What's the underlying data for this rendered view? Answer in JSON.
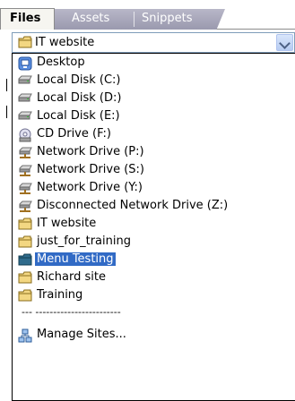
{
  "tabs": {
    "files": "Files",
    "assets": "Assets",
    "snippets": "Snippets"
  },
  "site_select": {
    "value": "IT website"
  },
  "dropdown": {
    "items": [
      {
        "label": "Desktop",
        "icon": "desktop-icon"
      },
      {
        "label": "Local Disk (C:)",
        "icon": "hard-disk-icon"
      },
      {
        "label": "Local Disk (D:)",
        "icon": "hard-disk-icon"
      },
      {
        "label": "Local Disk (E:)",
        "icon": "hard-disk-icon"
      },
      {
        "label": "CD Drive (F:)",
        "icon": "cd-drive-icon"
      },
      {
        "label": "Network Drive (P:)",
        "icon": "network-drive-icon"
      },
      {
        "label": "Network Drive (S:)",
        "icon": "network-drive-icon"
      },
      {
        "label": "Network Drive (Y:)",
        "icon": "network-drive-icon"
      },
      {
        "label": "Disconnected Network Drive (Z:)",
        "icon": "network-drive-icon"
      },
      {
        "label": "IT website",
        "icon": "folder-icon"
      },
      {
        "label": "just_for_training",
        "icon": "folder-icon"
      },
      {
        "label": "Menu Testing",
        "icon": "folder-icon",
        "selected": true
      },
      {
        "label": "Richard site",
        "icon": "folder-icon"
      },
      {
        "label": "Training",
        "icon": "folder-icon"
      }
    ],
    "separator": "--- ------------------------",
    "manage_sites": "Manage Sites..."
  },
  "colors": {
    "selection": "#316ac5",
    "folder": "#e8c86a"
  }
}
